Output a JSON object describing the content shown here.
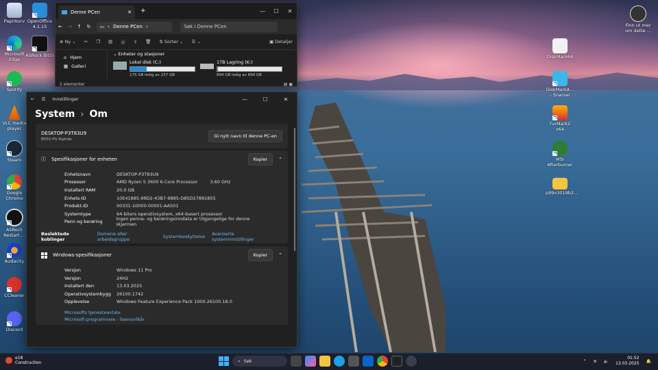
{
  "desktop": {
    "left_icons": [
      {
        "label": "Papirkurv"
      },
      {
        "label": "OpenOffice 4.1.15"
      },
      {
        "label": "Microsoft Edge"
      },
      {
        "label": "ASRock BIOS"
      },
      {
        "label": "Spotify"
      },
      {
        "label": "VLC media player"
      },
      {
        "label": "Steam"
      },
      {
        "label": "Google Chrome"
      },
      {
        "label": "ASRock Restart ..."
      },
      {
        "label": "Audacity"
      },
      {
        "label": "CCleaner"
      },
      {
        "label": "Discord"
      }
    ],
    "right_icons": [
      {
        "label": "Finn ut mer om dette ..."
      },
      {
        "label": "DiskMark64"
      },
      {
        "label": "DiskMarkA... - Snarvei"
      },
      {
        "label": "FurMark2 x64"
      },
      {
        "label": "MSI Afterburner"
      },
      {
        "label": "p99v3019b2..."
      }
    ]
  },
  "explorer": {
    "tab_title": "Denne PCen",
    "breadcrumb": "Denne PCen",
    "search_placeholder": "Søk i Denne PCen",
    "toolbar": {
      "new": "Ny",
      "sort": "Sorter",
      "details": "Detaljer"
    },
    "nav": [
      "Hjem",
      "Galleri"
    ],
    "group_title": "Enheter og stasjoner",
    "drives": [
      {
        "name": "Lokal disk (C:)",
        "free": "175 GB ledig av 237 GB",
        "used_fraction": 0.26
      },
      {
        "name": "1TB Lagring (K:)",
        "free": "894 GB ledig av 894 GB",
        "used_fraction": 0.01
      }
    ],
    "status": "2 elementer"
  },
  "settings": {
    "app_title": "Innstillinger",
    "crumb_parent": "System",
    "crumb_current": "Om",
    "device_name": "DESKTOP-P3T83U9",
    "device_model": "B550 PG Riptide",
    "rename_button": "Gi nytt navn til denne PC-en",
    "device_spec": {
      "title": "Spesifikasjoner for enheten",
      "copy": "Kopier",
      "rows": [
        {
          "k": "Enhetsnavn",
          "v": "DESKTOP-P3T83U9",
          "x": ""
        },
        {
          "k": "Prosessor",
          "v": "AMD Ryzen 5 3600 6-Core Processor",
          "x": "3.60 GHz"
        },
        {
          "k": "Installert RAM",
          "v": "20.0 GB",
          "x": ""
        },
        {
          "k": "Enhets-ID",
          "v": "10E41885-99D2-43B7-9885-D85D27881855",
          "x": ""
        },
        {
          "k": "Produkt-ID",
          "v": "00331-10000-00001-AA501",
          "x": ""
        },
        {
          "k": "Systemtype",
          "v": "64-biters operativsystem, x64-basert prosessor",
          "x": ""
        },
        {
          "k": "Penn og berøring",
          "v": "Ingen penne- og berøringsinndata er tilgjengelige for denne skjermen",
          "x": ""
        }
      ]
    },
    "related": {
      "label": "Beslektede koblinger",
      "links": [
        "Domene eller arbeidsgruppe",
        "Systembeskyttelse",
        "Avanserte systeminnstillinger"
      ]
    },
    "windows_spec": {
      "title": "Windows-spesifikasjoner",
      "copy": "Kopier",
      "rows": [
        {
          "k": "Versjon",
          "v": "Windows 11 Pro"
        },
        {
          "k": "Versjon",
          "v": "24H2"
        },
        {
          "k": "Installert den",
          "v": "13.03.2025"
        },
        {
          "k": "Operativsystembygg",
          "v": "26100.1742"
        },
        {
          "k": "Opplevelse",
          "v": "Windows Feature Experience Pack 1000.26100.18.0"
        }
      ],
      "links": [
        "Microsofts tjenesteavtale",
        "Microsoft-programvare - lisensvilkår"
      ]
    }
  },
  "taskbar": {
    "weather_temp": "e18",
    "weather_text": "Construction",
    "search": "Søk",
    "time": "01:52",
    "date": "13.03.2025"
  },
  "colors": {
    "accent": "#1f8fd8",
    "link": "#6cb8f0",
    "window": "#202020",
    "card": "#2b2b2b"
  }
}
